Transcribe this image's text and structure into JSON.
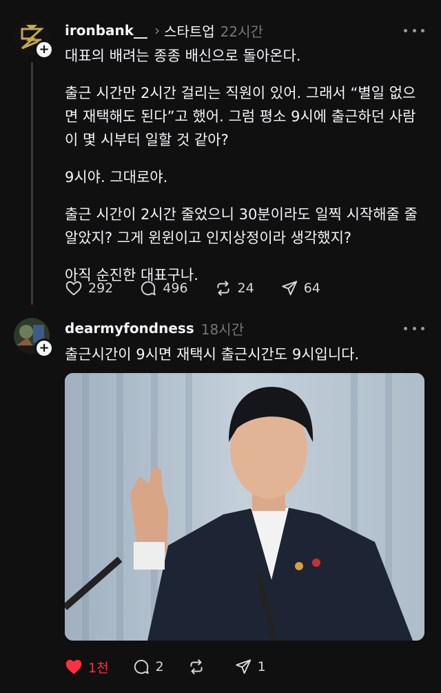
{
  "post1": {
    "username": "ironbank__",
    "topic": "스타트업",
    "time": "22시간",
    "paragraphs": [
      "대표의 배려는 종종 배신으로 돌아온다.",
      "출근 시간만 2시간 걸리는 직원이 있어. 그래서 “별일 없으면 재택해도 된다”고 했어. 그럼 평소 9시에 출근하던 사람이 몇 시부터 일할 것 같아?",
      "9시야. 그대로야.",
      "출근 시간이 2시간 줄었으니 30분이라도 일찍 시작해줄 줄 알았지? 그게 윈윈이고 인지상정이라 생각했지?",
      "아직 순진한 대표구나."
    ],
    "likes": "292",
    "replies": "496",
    "reposts": "24",
    "shares": "64"
  },
  "post2": {
    "username": "dearmyfondness",
    "time": "18시간",
    "text": "출근시간이 9시면 재택시 출근시간도 9시입니다.",
    "likes": "1천",
    "replies": "2",
    "reposts": "",
    "shares": "1",
    "image": "man-in-suit-at-podium-photo"
  },
  "colors": {
    "background": "#101010",
    "text": "#f3f5f7",
    "secondary": "#777777",
    "like_active": "#ff3040"
  },
  "icons": [
    "heart-icon",
    "comment-icon",
    "repost-icon",
    "share-icon",
    "more-icon",
    "follow-plus-icon"
  ]
}
